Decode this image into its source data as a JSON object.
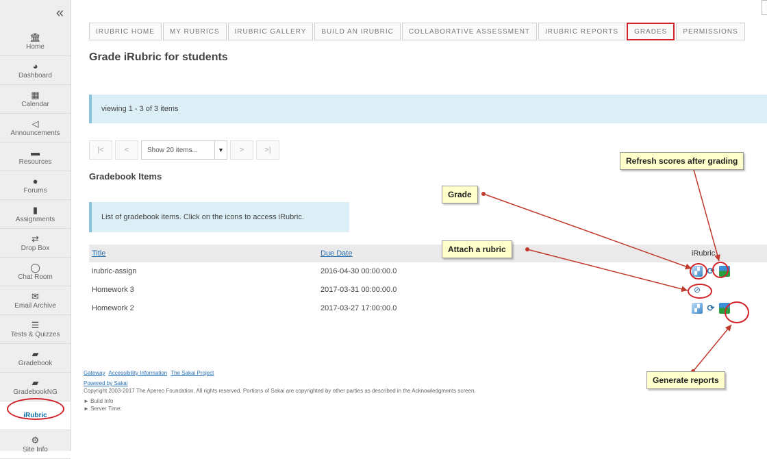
{
  "sidebar": {
    "collapse_icon": "«",
    "items": [
      {
        "label": "Home",
        "icon": "home-icon",
        "glyph": "🏛"
      },
      {
        "label": "Dashboard",
        "icon": "dashboard-icon",
        "glyph": "◕"
      },
      {
        "label": "Calendar",
        "icon": "calendar-icon",
        "glyph": "▦"
      },
      {
        "label": "Announcements",
        "icon": "megaphone-icon",
        "glyph": "◁"
      },
      {
        "label": "Resources",
        "icon": "folder-icon",
        "glyph": "▬"
      },
      {
        "label": "Forums",
        "icon": "forum-icon",
        "glyph": "●"
      },
      {
        "label": "Assignments",
        "icon": "assignment-icon",
        "glyph": "▮"
      },
      {
        "label": "Drop Box",
        "icon": "dropbox-icon",
        "glyph": "⇄"
      },
      {
        "label": "Chat Room",
        "icon": "chat-icon",
        "glyph": "◯"
      },
      {
        "label": "Email Archive",
        "icon": "email-icon",
        "glyph": "✉"
      },
      {
        "label": "Tests & Quizzes",
        "icon": "quiz-icon",
        "glyph": "☰"
      },
      {
        "label": "Gradebook",
        "icon": "gradebook-icon",
        "glyph": "▰"
      },
      {
        "label": "GradebookNG",
        "icon": "gradebookng-icon",
        "glyph": "▰"
      },
      {
        "label": "iRubric",
        "icon": "",
        "glyph": ""
      },
      {
        "label": "Site Info",
        "icon": "gear-icon",
        "glyph": "⚙"
      }
    ]
  },
  "tabs": [
    "IRUBRIC HOME",
    "MY RUBRICS",
    "IRUBRIC GALLERY",
    "BUILD AN IRUBRIC",
    "COLLABORATIVE ASSESSMENT",
    "IRUBRIC REPORTS",
    "GRADES",
    "PERMISSIONS"
  ],
  "page_title": "Grade iRubric for students",
  "viewing_text": "viewing 1 - 3 of 3 items",
  "pager": {
    "first": "|<",
    "prev": "<",
    "select_value": "Show 20 items...",
    "caret": "▼",
    "next": ">",
    "last": ">|"
  },
  "section_title": "Gradebook Items",
  "list_info": "List of gradebook items. Click on the icons to access iRubric.",
  "table": {
    "headers": {
      "title": "Title",
      "due": "Due Date",
      "irubric": "iRubric"
    },
    "rows": [
      {
        "title": "irubric-assign",
        "due": "2016-04-30 00:00:00.0"
      },
      {
        "title": "Homework 3",
        "due": "2017-03-31 00:00:00.0"
      },
      {
        "title": "Homework 2",
        "due": "2017-03-27 17:00:00.0"
      }
    ]
  },
  "footer": {
    "links": [
      "Gateway",
      "Accessibility Information",
      "The Sakai Project"
    ],
    "powered": "Powered by Sakai",
    "copyright": "Copyright 2003-2017 The Apereo Foundation. All rights reserved. Portions of Sakai are copyrighted by other parties as described in the Acknowledgments screen.",
    "build_info": "► Build Info",
    "server_time": "► Server Time:"
  },
  "callouts": {
    "refresh": "Refresh scores after grading",
    "grade": "Grade",
    "attach": "Attach a rubric",
    "reports": "Generate reports"
  },
  "colors": {
    "highlight": "#d2232a",
    "info_bg": "#dceef6",
    "link": "#2a6fb0",
    "callout_bg": "#ffffcc"
  }
}
